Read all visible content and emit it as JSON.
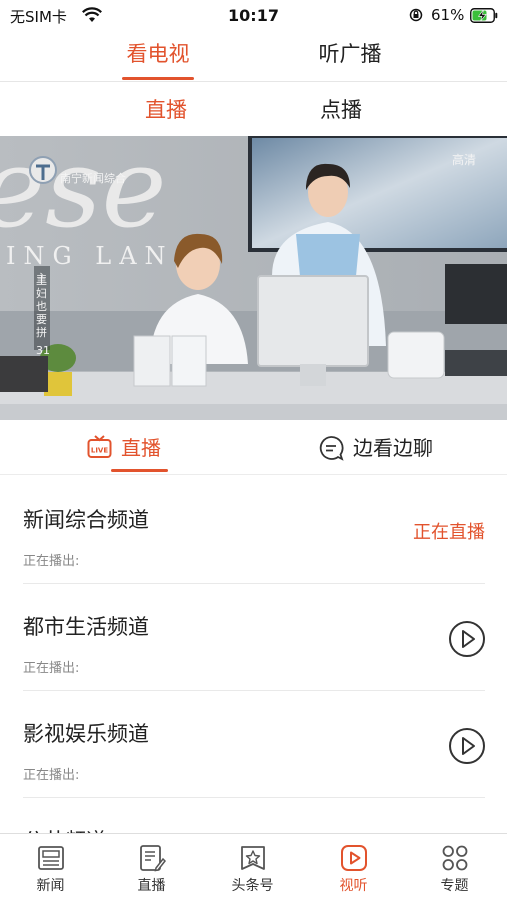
{
  "status_bar": {
    "carrier": "无SIM卡",
    "time": "10:17",
    "battery": "61%"
  },
  "top_tabs": [
    "看电视",
    "听广播"
  ],
  "sub_tabs": [
    "直播",
    "点播"
  ],
  "video": {
    "quality": "高清",
    "station_logo": "南宁新闻综合",
    "sign_text": "ING LAN",
    "side_caption": "主妇也要拼",
    "side_number": "31"
  },
  "content_tabs": [
    "直播",
    "边看边聊"
  ],
  "channels": [
    {
      "name": "新闻综合频道",
      "subtitle": "正在播出:",
      "status": "正在直播"
    },
    {
      "name": "都市生活频道",
      "subtitle": "正在播出:"
    },
    {
      "name": "影视娱乐频道",
      "subtitle": "正在播出:"
    },
    {
      "name": "公共频道"
    }
  ],
  "bottom_nav": [
    "新闻",
    "直播",
    "头条号",
    "视听",
    "专题"
  ],
  "colors": {
    "accent": "#e2532d"
  }
}
